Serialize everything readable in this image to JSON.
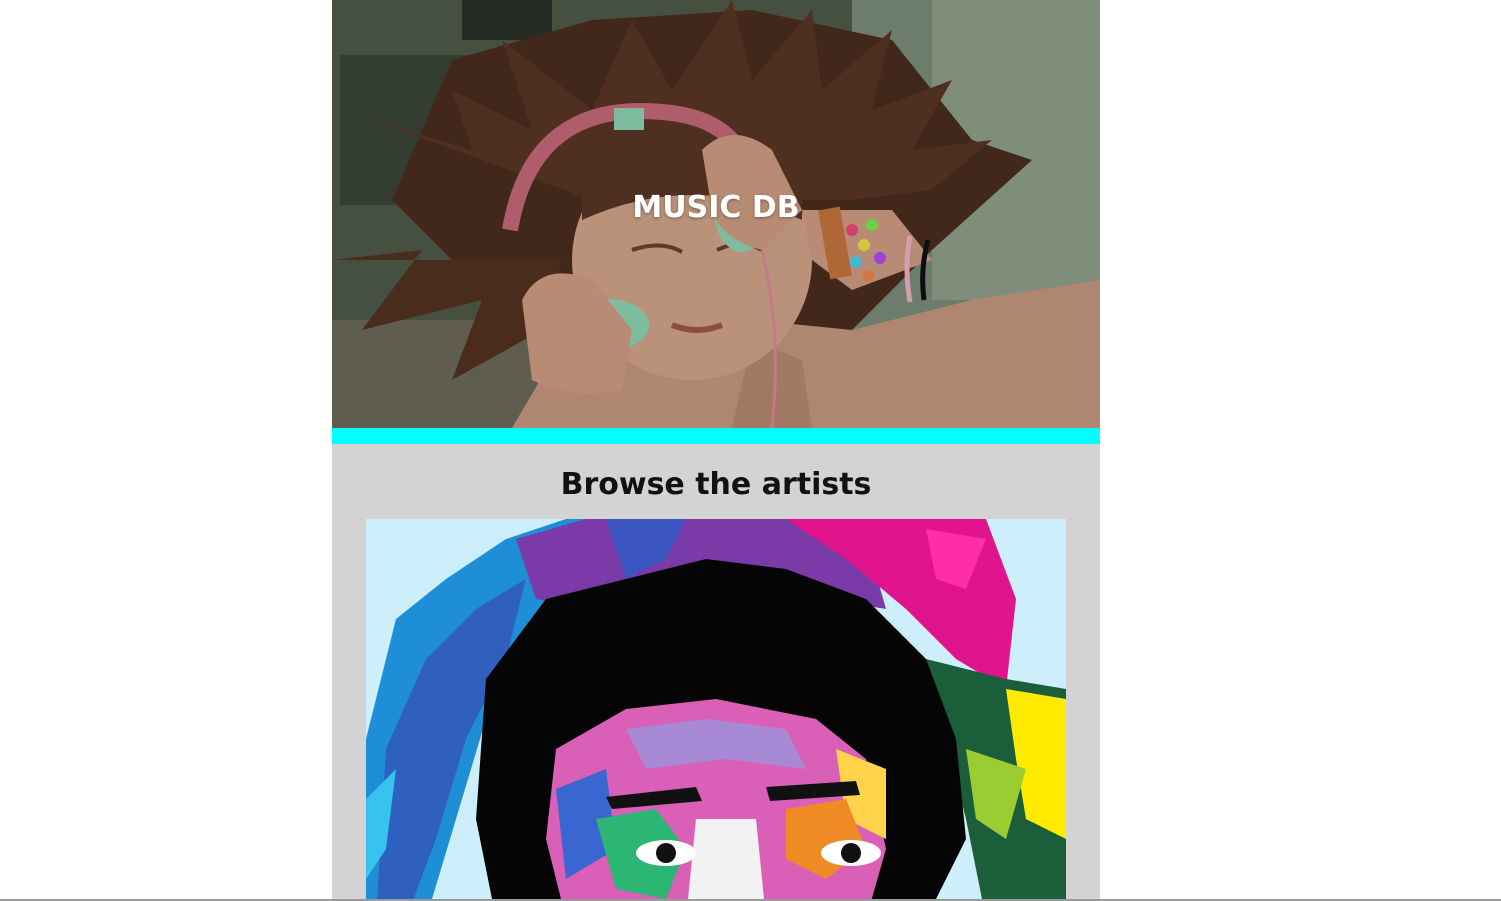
{
  "header": {
    "title": "MUSIC DB",
    "hero_image": "girl-with-headphones-photo"
  },
  "colors": {
    "accent": "#00ffff",
    "section_background": "#d3d3d3",
    "page_background": "#ffffff"
  },
  "browse": {
    "heading": "Browse the artists",
    "featured_artist_image": "pop-art-portrait-illustration"
  }
}
